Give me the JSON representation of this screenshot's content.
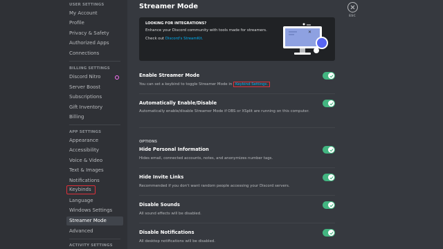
{
  "sidebar": {
    "sections": {
      "user": "USER SETTINGS",
      "billing": "BILLING SETTINGS",
      "app": "APP SETTINGS",
      "activity": "ACTIVITY SETTINGS"
    },
    "items": [
      "My Account",
      "Profile",
      "Privacy & Safety",
      "Authorized Apps",
      "Connections",
      "Discord Nitro",
      "Server Boost",
      "Subscriptions",
      "Gift Inventory",
      "Billing",
      "Appearance",
      "Accessibility",
      "Voice & Video",
      "Text & Images",
      "Notifications",
      "Keybinds",
      "Language",
      "Windows Settings",
      "Streamer Mode",
      "Advanced"
    ],
    "active": "Streamer Mode"
  },
  "page": {
    "title": "Streamer Mode"
  },
  "banner": {
    "title": "LOOKING FOR INTEGRATIONS?",
    "desc": "Enhance your Discord community with tools made for streamers.",
    "check_prefix": "Check out ",
    "check_link": "Discord's StreamKit."
  },
  "settings": {
    "enable": {
      "title": "Enable Streamer Mode",
      "desc_prefix": "You can set a keybind to toggle Streamer Mode in ",
      "desc_link": "Keybind Settings.",
      "enabled": true
    },
    "auto": {
      "title": "Automatically Enable/Disable",
      "desc": "Automatically enable/disable Streamer Mode if OBS or XSplit are running on this computer.",
      "enabled": true
    },
    "options_header": "OPTIONS",
    "personal": {
      "title": "Hide Personal Information",
      "desc": "Hides email, connected accounts, notes, and anonymizes number tags.",
      "enabled": true
    },
    "invite": {
      "title": "Hide Invite Links",
      "desc": "Recommended if you don't want random people accessing your Discord servers.",
      "enabled": true
    },
    "sounds": {
      "title": "Disable Sounds",
      "desc": "All sound effects will be disabled.",
      "enabled": true
    },
    "notifs": {
      "title": "Disable Notifications",
      "desc": "All desktop notifications will be disabled.",
      "enabled": true
    }
  },
  "close": {
    "label": "ESC"
  },
  "colors": {
    "accent_green": "#43b581",
    "link": "#00b0f4",
    "highlight_red": "#e0303a",
    "nitro_pink": "#ff73fa"
  }
}
